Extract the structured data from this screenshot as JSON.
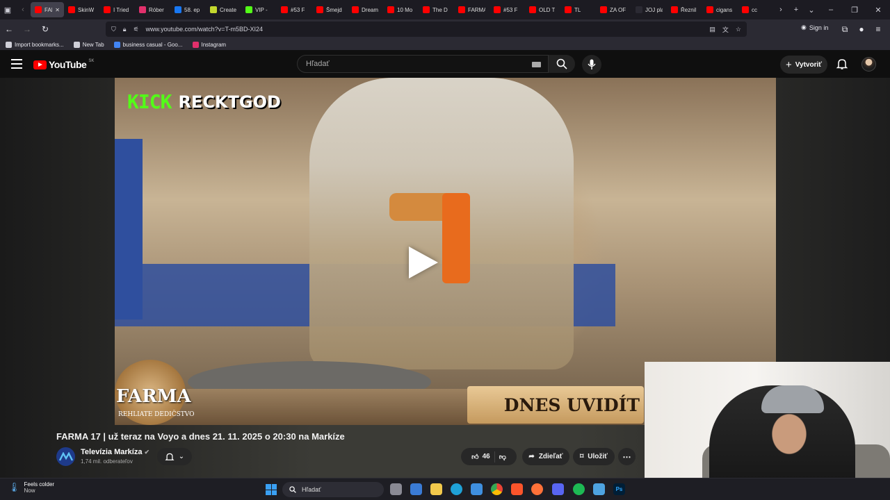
{
  "browser": {
    "tabs": [
      {
        "label": "FARMA",
        "color": "#ff0000",
        "active": true
      },
      {
        "label": "SkinW",
        "color": "#ff0000"
      },
      {
        "label": "I Tried",
        "color": "#ff0000"
      },
      {
        "label": "Róber",
        "color": "#e1306c"
      },
      {
        "label": "58. ep",
        "color": "#1877f2"
      },
      {
        "label": "Create",
        "color": "#c4d82e"
      },
      {
        "label": "VIP -",
        "color": "#53fc18"
      },
      {
        "label": "#53 F",
        "color": "#ff0000"
      },
      {
        "label": "Šmejd",
        "color": "#ff0000"
      },
      {
        "label": "Dream",
        "color": "#ff0000"
      },
      {
        "label": "10 Mo",
        "color": "#ff0000"
      },
      {
        "label": "The D",
        "color": "#ff0000"
      },
      {
        "label": "FARMA",
        "color": "#ff0000"
      },
      {
        "label": "#53 F",
        "color": "#ff0000"
      },
      {
        "label": "OLD T",
        "color": "#ff0000"
      },
      {
        "label": "TL",
        "color": "#ff0000"
      },
      {
        "label": "ZA OF",
        "color": "#ff0000"
      },
      {
        "label": "JOJ play",
        "color": "#2b2a33"
      },
      {
        "label": "Řeznil",
        "color": "#ff0000"
      },
      {
        "label": "cigans",
        "color": "#ff0000"
      },
      {
        "label": "cc",
        "color": "#ff0000"
      }
    ],
    "url": "www.youtube.com/watch?v=T-m5BD-XI24",
    "sign_in": "Sign in",
    "bookmarks": [
      {
        "label": "Import bookmarks...",
        "icon": "import-icon"
      },
      {
        "label": "New Tab",
        "icon": "globe-icon"
      },
      {
        "label": "business casual - Goo...",
        "icon": "google-icon"
      },
      {
        "label": "Instagram",
        "icon": "instagram-icon"
      }
    ]
  },
  "youtube": {
    "logo_text": "YouTube",
    "country": "SK",
    "search_placeholder": "Hľadať",
    "create_label": "Vytvoriť",
    "accent": "#ff0000"
  },
  "video": {
    "overlay_kick": "KICK",
    "overlay_user": "RECKTGOD",
    "show_logo": "FARMA",
    "show_sub": "REHLIATE DEDIČSTVO",
    "banner": "DNES UVIDÍT",
    "title": "FARMA 17 | už teraz na Voyo a dnes 21. 11. 2025 o 20:30 na Markíze",
    "channel": "Televízia Markíza",
    "subscribers": "1,74 mil. odberateľov",
    "likes": "46",
    "share_label": "Zdieľať",
    "save_label": "Uložiť"
  },
  "taskbar": {
    "weather_title": "Feels colder",
    "weather_sub": "Now",
    "search_placeholder": "Hľadať"
  }
}
